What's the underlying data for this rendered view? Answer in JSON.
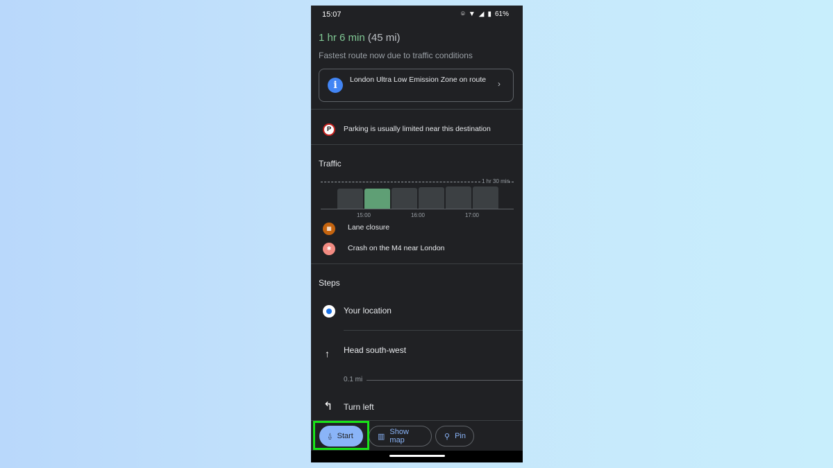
{
  "status_bar": {
    "time": "15:07",
    "battery": "61%",
    "icons": [
      "location-icon",
      "wifi-icon",
      "signal-icon",
      "battery-icon"
    ]
  },
  "route": {
    "duration": "1 hr 6 min",
    "distance": "(45 mi)",
    "subtitle": "Fastest route now due to traffic conditions"
  },
  "alert_card": {
    "icon": "info-icon",
    "text": "London Ultra Low Emission Zone on route"
  },
  "parking": {
    "icon": "parking-icon",
    "text": "Parking is usually limited near this destination"
  },
  "traffic": {
    "heading": "Traffic",
    "chart_data": {
      "type": "bar",
      "reference_label": "1 hr 30 min",
      "reference_value": 90,
      "tick_labels": [
        "15:00",
        "16:00",
        "17:00"
      ],
      "values": [
        67,
        66,
        69,
        71,
        73,
        75
      ],
      "current_index": 1,
      "colors": {
        "bar": "#3c4043",
        "current": "#5f9f75"
      }
    },
    "incidents": [
      {
        "icon": "lane-closure-icon",
        "text": "Lane closure",
        "color": "#c5640f"
      },
      {
        "icon": "crash-icon",
        "text": "Crash on the M4 near London",
        "color": "#f28b82"
      }
    ]
  },
  "steps": {
    "heading": "Steps",
    "items": [
      {
        "icon": "location-dot-icon",
        "text": "Your location"
      },
      {
        "icon": "arrow-up-icon",
        "text": "Head south-west",
        "distance": "0.1 mi"
      },
      {
        "icon": "turn-left-icon",
        "text": "Turn left"
      }
    ]
  },
  "actions": {
    "start": "Start",
    "show_map": "Show map",
    "pin": "Pin"
  },
  "accent": "#8ab4f8",
  "highlight": "#19e319"
}
